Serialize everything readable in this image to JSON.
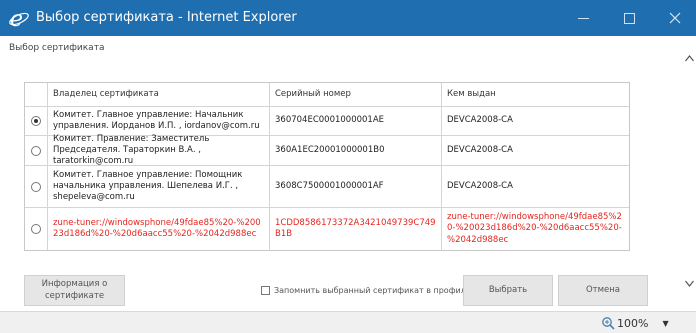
{
  "window": {
    "title": "Выбор сертификата - Internet Explorer",
    "colors": {
      "titlebar": "#1f6fb0",
      "accent_red": "#e4261f"
    }
  },
  "dialog": {
    "subtitle": "Выбор сертификата",
    "columns": [
      "Владелец сертификата",
      "Серийный номер",
      "Кем выдан"
    ],
    "rows": [
      {
        "selected": true,
        "owner": "Комитет. Главное управление: Начальник управления. Иорданов И.П. , iordanov@com.ru",
        "serial": "360704EC0001000001AE",
        "issuer": "DEVCA2008-CA"
      },
      {
        "selected": false,
        "owner": "Комитет. Правление: Заместитель Председателя. Тараторкин В.А. , taratorkin@com.ru",
        "serial": "360A1EC20001000001B0",
        "issuer": "DEVCA2008-CA"
      },
      {
        "selected": false,
        "owner": "Комитет. Главное управление: Помощник начальника управления. Шепелева И.Г. , shepeleva@com.ru",
        "serial": "3608C7500001000001AF",
        "issuer": "DEVCA2008-CA"
      },
      {
        "selected": false,
        "owner": "zune-tuner://windowsphone/49fdae85%20-%20023d186d%20-%20d6aacc55%20-%2042d988ec",
        "serial": "1CDD8586173372A3421049739C749B1B",
        "issuer": "zune-tuner://windowsphone/49fdae85%20-%20023d186d%20-%20d6aacc55%20-%2042d988ec"
      }
    ],
    "info_button": "Информация о сертификате",
    "remember_label": "Запомнить выбранный сертификат в профиле",
    "choose_button": "Выбрать",
    "cancel_button": "Отмена"
  },
  "status": {
    "zoom": "100%"
  }
}
